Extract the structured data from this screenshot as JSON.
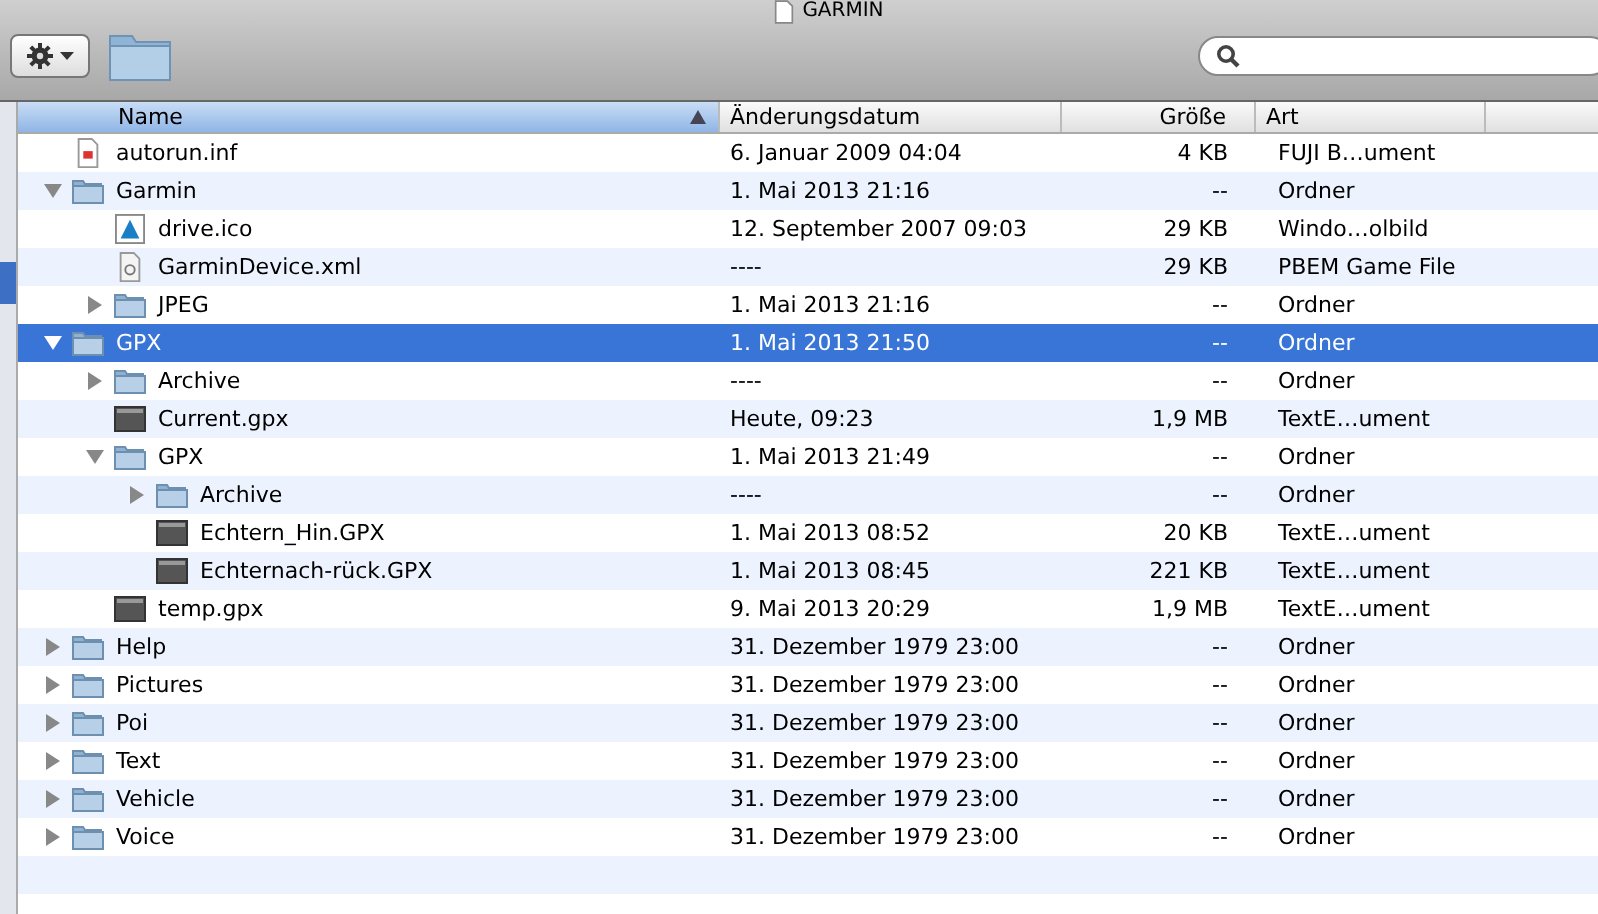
{
  "window": {
    "title": "GARMIN"
  },
  "columns": [
    {
      "label": "Name",
      "selected": true
    },
    {
      "label": "Änderungsdatum",
      "selected": false
    },
    {
      "label": "Größe",
      "selected": false
    },
    {
      "label": "Art",
      "selected": false
    }
  ],
  "items": [
    {
      "kind": "document",
      "name": "autorun.inf",
      "date": "6. Januar 2009 04:04",
      "size": "4 KB",
      "type": "FUJI B…ument",
      "selected": false
    },
    {
      "kind": "folder",
      "name": "Garmin",
      "date": "1. Mai 2013 21:16",
      "size": "--",
      "type": "Ordner",
      "selected": false,
      "expanded": true,
      "children": [
        {
          "kind": "image",
          "name": "drive.ico",
          "date": "12. September 2007 09:03",
          "size": "29 KB",
          "type": "Windo…olbild",
          "selected": false
        },
        {
          "kind": "xml",
          "name": "GarminDevice.xml",
          "date": "----",
          "size": "29 KB",
          "type": "PBEM Game File",
          "selected": false
        },
        {
          "kind": "folder",
          "name": "JPEG",
          "date": "1. Mai 2013 21:16",
          "size": "--",
          "type": "Ordner",
          "selected": false,
          "expanded": false
        }
      ]
    },
    {
      "kind": "folder",
      "name": "GPX",
      "date": "1. Mai 2013 21:50",
      "size": "--",
      "type": "Ordner",
      "selected": true,
      "expanded": true,
      "children": [
        {
          "kind": "folder",
          "name": "Archive",
          "date": "----",
          "size": "--",
          "type": "Ordner",
          "selected": false,
          "expanded": false
        },
        {
          "kind": "track",
          "name": "Current.gpx",
          "date": "Heute, 09:23",
          "size": "1,9 MB",
          "type": "TextE…ument",
          "selected": false
        },
        {
          "kind": "folder",
          "name": "GPX",
          "date": "1. Mai 2013 21:49",
          "size": "--",
          "type": "Ordner",
          "selected": false,
          "expanded": true,
          "children": [
            {
              "kind": "folder",
              "name": "Archive",
              "date": "----",
              "size": "--",
              "type": "Ordner",
              "selected": false,
              "expanded": false
            },
            {
              "kind": "track",
              "name": "Echtern_Hin.GPX",
              "date": "1. Mai 2013 08:52",
              "size": "20 KB",
              "type": "TextE…ument",
              "selected": false
            },
            {
              "kind": "track",
              "name": "Echternach-rück.GPX",
              "date": "1. Mai 2013 08:45",
              "size": "221 KB",
              "type": "TextE…ument",
              "selected": false
            }
          ]
        },
        {
          "kind": "track",
          "name": "temp.gpx",
          "date": "9. Mai 2013 20:29",
          "size": "1,9 MB",
          "type": "TextE…ument",
          "selected": false
        }
      ]
    },
    {
      "kind": "folder",
      "name": "Help",
      "date": "31. Dezember 1979 23:00",
      "size": "--",
      "type": "Ordner",
      "selected": false,
      "expanded": false
    },
    {
      "kind": "folder",
      "name": "Pictures",
      "date": "31. Dezember 1979 23:00",
      "size": "--",
      "type": "Ordner",
      "selected": false,
      "expanded": false
    },
    {
      "kind": "folder",
      "name": "Poi",
      "date": "31. Dezember 1979 23:00",
      "size": "--",
      "type": "Ordner",
      "selected": false,
      "expanded": false
    },
    {
      "kind": "folder",
      "name": "Text",
      "date": "31. Dezember 1979 23:00",
      "size": "--",
      "type": "Ordner",
      "selected": false,
      "expanded": false
    },
    {
      "kind": "folder",
      "name": "Vehicle",
      "date": "31. Dezember 1979 23:00",
      "size": "--",
      "type": "Ordner",
      "selected": false,
      "expanded": false
    },
    {
      "kind": "folder",
      "name": "Voice",
      "date": "31. Dezember 1979 23:00",
      "size": "--",
      "type": "Ordner",
      "selected": false,
      "expanded": false
    }
  ]
}
